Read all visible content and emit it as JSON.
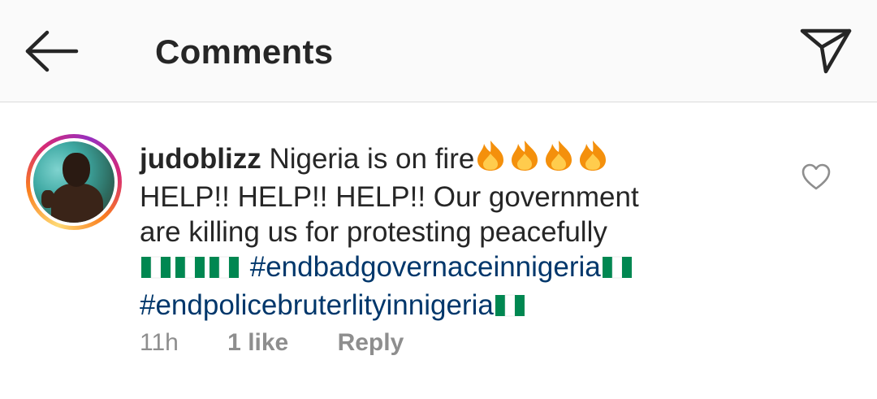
{
  "header": {
    "title": "Comments",
    "back_icon": "arrow-left-icon",
    "share_icon": "paper-plane-icon"
  },
  "comment": {
    "username": "judoblizz",
    "text_line1": "Nigeria is on fire",
    "fire_emoji_count": 4,
    "text_rest": "HELP!! HELP!! HELP!! Our government are killing us for protesting peacefully",
    "leading_flags_count": 3,
    "hashtag1": "#endbadgovernaceinnigeria",
    "hashtag2": "#endpolicebruterlityinnigeria",
    "time": "11h",
    "likes": "1 like",
    "reply_label": "Reply",
    "like_icon": "heart-outline-icon"
  },
  "colors": {
    "header_bg": "#fafafa",
    "text": "#262626",
    "hashtag": "#00376b",
    "meta": "#8e8e8e",
    "flag_green": "#008751"
  }
}
